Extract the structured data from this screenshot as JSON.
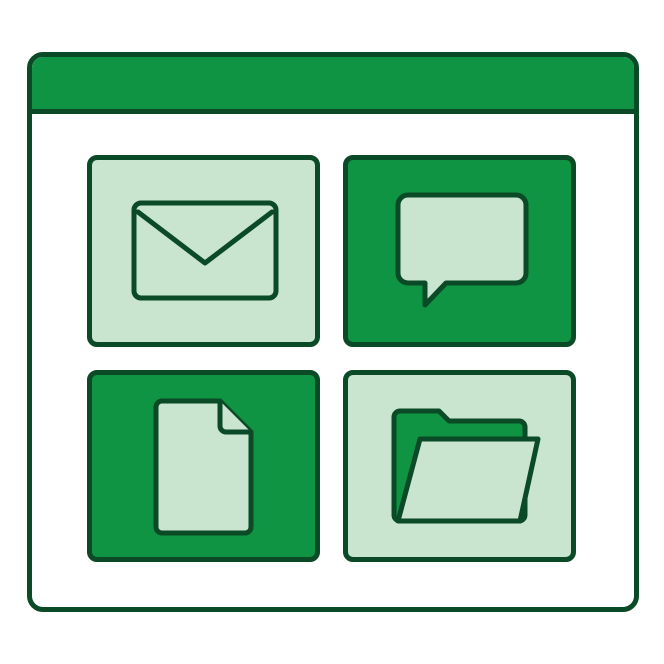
{
  "colors": {
    "outline": "#0b4a26",
    "accent": "#0e9443",
    "tile_light": "#c9e4cf",
    "window_background": "#ffffff"
  },
  "window": {
    "title_bar_icon": "none"
  },
  "tiles": [
    {
      "icon": "envelope-icon",
      "style": "light"
    },
    {
      "icon": "speech-bubble-icon",
      "style": "dark"
    },
    {
      "icon": "document-icon",
      "style": "dark"
    },
    {
      "icon": "folder-icon",
      "style": "light"
    }
  ]
}
